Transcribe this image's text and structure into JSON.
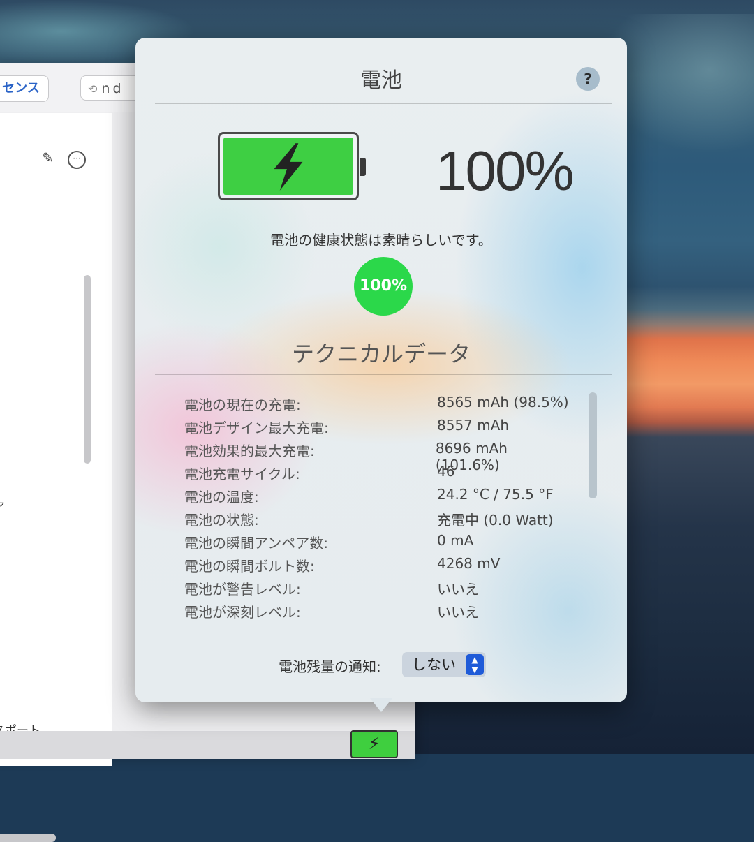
{
  "background_window": {
    "license_button": "センス",
    "search_text": "nd",
    "list_text_1": "ア",
    "list_text_2": "スポート"
  },
  "popover": {
    "title": "電池",
    "help_label": "?",
    "battery_level": "100%",
    "battery_level_fraction": 1.0,
    "health_message": "電池の健康状態は素晴らしいです。",
    "health_percent": "100%",
    "tech_title": "テクニカルデータ",
    "tech_rows": [
      {
        "label": "電池の現在の充電:",
        "value": "8565 mAh (98.5%)"
      },
      {
        "label": "電池デザイン最大充電:",
        "value": "8557 mAh"
      },
      {
        "label": "電池効果的最大充電:",
        "value": "8696 mAh (101.6%)"
      },
      {
        "label": "電池充電サイクル:",
        "value": "46"
      },
      {
        "label": "電池の温度:",
        "value": "24.2 °C / 75.5 °F"
      },
      {
        "label": "電池の状態:",
        "value": "充電中 (0.0 Watt)"
      },
      {
        "label": "電池の瞬間アンペア数:",
        "value": "0 mA"
      },
      {
        "label": "電池の瞬間ボルト数:",
        "value": "4268 mV"
      },
      {
        "label": "電池が警告レベル:",
        "value": "いいえ"
      },
      {
        "label": "電池が深刻レベル:",
        "value": "いいえ"
      }
    ],
    "notify_label": "電池残量の通知:",
    "notify_value": "しない"
  },
  "colors": {
    "battery_green": "#3ecf43",
    "health_green": "#2bd84a",
    "stepper_blue": "#1f5bd8"
  },
  "icons": [
    "lightning-bolt-icon",
    "help-icon",
    "pencil-icon",
    "more-icon",
    "history-icon",
    "stepper-icon"
  ]
}
